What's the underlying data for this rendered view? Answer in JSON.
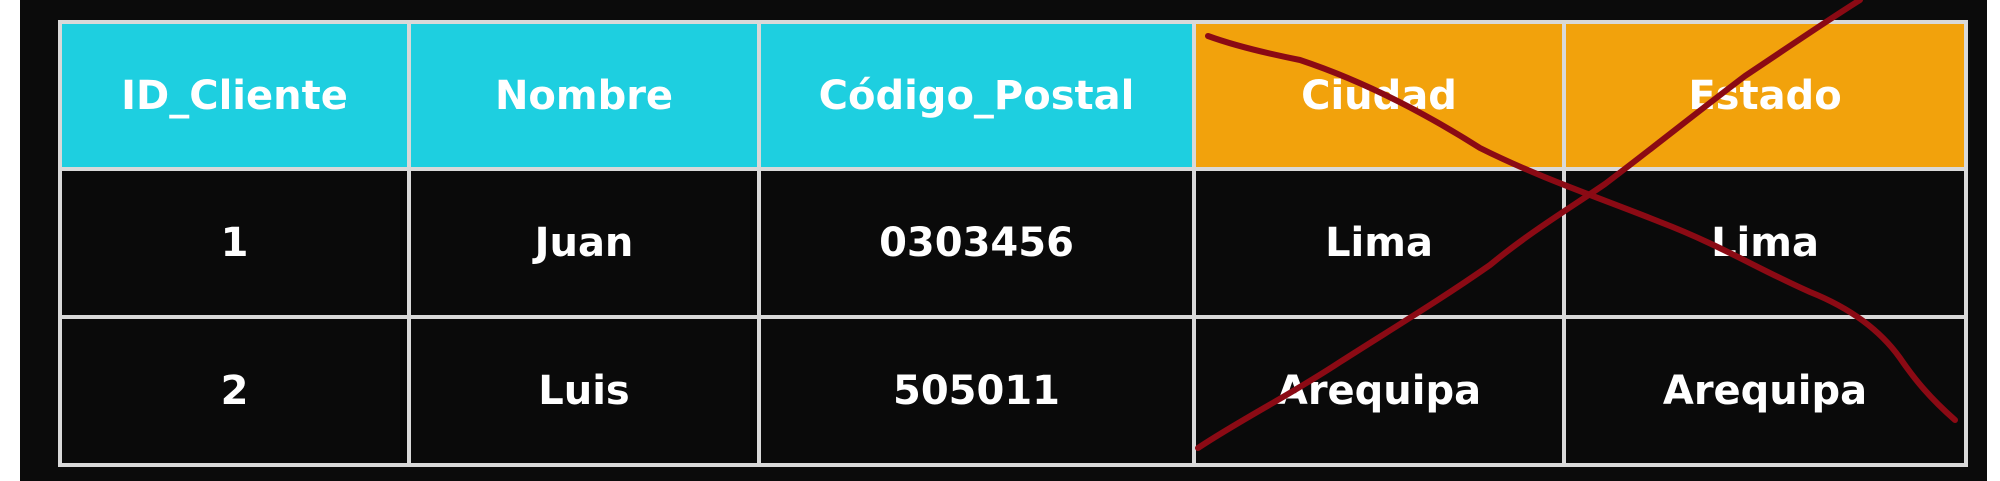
{
  "table": {
    "headers": [
      {
        "label": "ID_Cliente",
        "color": "#1ecfe0"
      },
      {
        "label": "Nombre",
        "color": "#1ecfe0"
      },
      {
        "label": "Código_Postal",
        "color": "#1ecfe0"
      },
      {
        "label": "Ciudad",
        "color": "#f2a20c"
      },
      {
        "label": "Estado",
        "color": "#f2a20c"
      }
    ],
    "rows": [
      [
        "1",
        "Juan",
        "0303456",
        "Lima",
        "Lima"
      ],
      [
        "2",
        "Luis",
        "505011",
        "Arequipa",
        "Arequipa"
      ]
    ]
  },
  "annotation": {
    "type": "red-x-strike-through",
    "color": "#8b0a14",
    "applies_to_columns": [
      "Ciudad",
      "Estado"
    ]
  }
}
